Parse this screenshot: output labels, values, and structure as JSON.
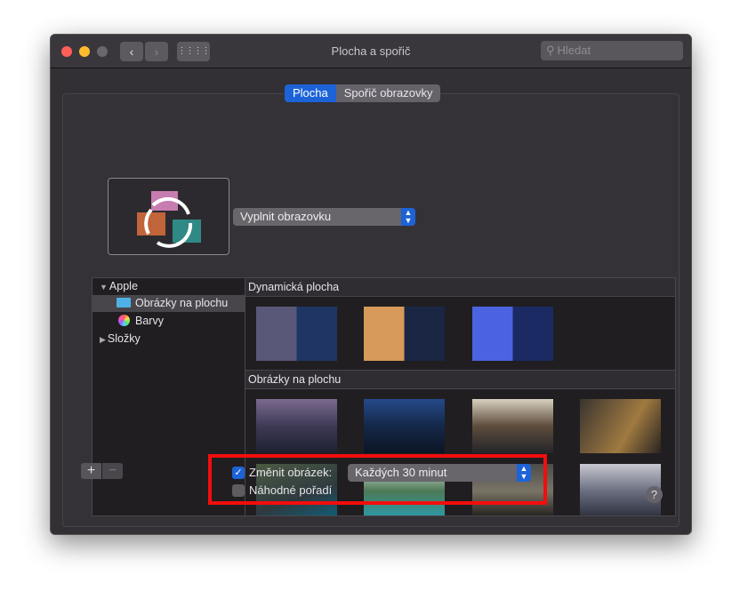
{
  "window": {
    "title": "Plocha a spořič",
    "search_placeholder": "Hledat",
    "colors": {
      "close": "#fe5f57",
      "minimize": "#febc2e",
      "accent": "#1d63d8",
      "highlight": "#f30d0d"
    }
  },
  "tabs": [
    {
      "label": "Plocha",
      "active": true
    },
    {
      "label": "Spořič obrazovky",
      "active": false
    }
  ],
  "fill_mode": {
    "value": "Vyplnit obrazovku"
  },
  "sidebar": {
    "items": [
      {
        "label": "Apple",
        "expanded": true
      },
      {
        "label": "Obrázky na plochu",
        "selected": true
      },
      {
        "label": "Barvy"
      },
      {
        "label": "Složky",
        "expanded": false
      }
    ]
  },
  "gallery": {
    "sections": [
      {
        "title": "Dynamická plocha",
        "count": 3
      },
      {
        "title": "Obrázky na plochu",
        "count": 8
      }
    ]
  },
  "list_buttons": {
    "add": "+",
    "remove": "−"
  },
  "change_picture": {
    "label": "Změnit obrázek:",
    "checked": true,
    "interval": "Každých 30 minut"
  },
  "random_order": {
    "label": "Náhodné pořadí",
    "checked": false
  },
  "help": "?"
}
